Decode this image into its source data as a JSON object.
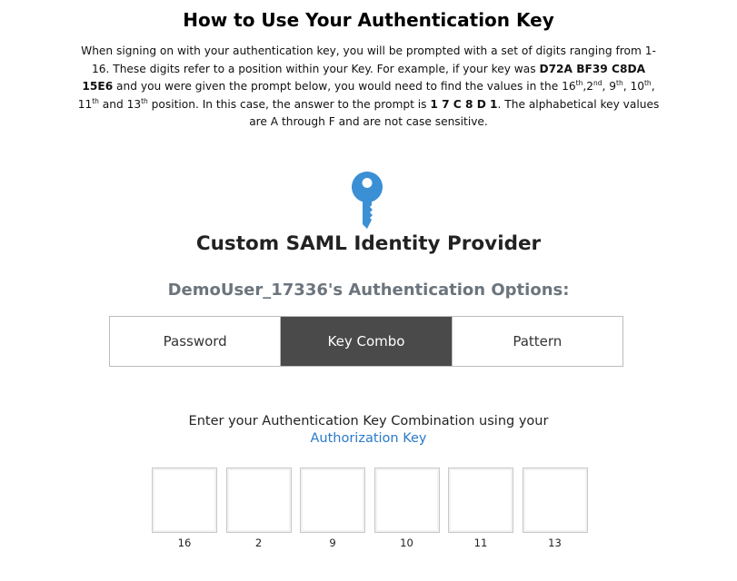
{
  "instructions": {
    "title": "How to Use Your Authentication Key",
    "p1": "When signing on with your authentication key, you will be prompted with a set of digits ranging from 1-16. These digits refer to a position within your Key. For example, if your key was ",
    "example_key": "D72A  BF39 C8DA 15E6",
    "p2": " and you were given the prompt below, you would need to find the values in the ",
    "positions": [
      {
        "num": "16",
        "suffix": "th",
        "after": ","
      },
      {
        "num": "2",
        "suffix": "nd",
        "after": ", "
      },
      {
        "num": "9",
        "suffix": "th",
        "after": ", "
      },
      {
        "num": "10",
        "suffix": "th",
        "after": ", "
      },
      {
        "num": "11",
        "suffix": "th",
        "after": " and "
      },
      {
        "num": "13",
        "suffix": "th",
        "after": ""
      }
    ],
    "p3": " position. In this case, the answer to the prompt is ",
    "answer": "1 7 C 8 D 1",
    "p4": ".  The alphabetical key values are A through F and are not case sensitive."
  },
  "provider": {
    "icon": "key-icon",
    "title": "Custom SAML Identity Provider"
  },
  "options": {
    "heading": "DemoUser_17336's Authentication Options:",
    "tabs": [
      {
        "label": "Password",
        "active": false
      },
      {
        "label": "Key Combo",
        "active": true
      },
      {
        "label": "Pattern",
        "active": false
      }
    ],
    "active_color": "#4a4a4a"
  },
  "prompt": {
    "text": "Enter your Authentication Key Combination using your",
    "link": "Authorization Key",
    "link_color": "#2b7ac9"
  },
  "digits": {
    "positions": [
      "16",
      "2",
      "9",
      "10",
      "11",
      "13"
    ],
    "values": [
      "",
      "",
      "",
      "",
      "",
      ""
    ]
  }
}
